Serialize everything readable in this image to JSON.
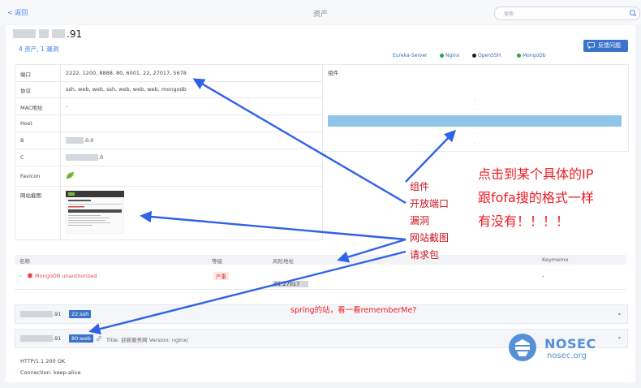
{
  "header": {
    "back": "< 返回",
    "title": "资产",
    "search_placeholder": "搜索"
  },
  "asset": {
    "ip_suffix": ".91",
    "counts": "4 资产, 1 漏洞",
    "feedback": "反馈问题"
  },
  "info_rows": [
    {
      "label": "端口",
      "value": "2222, 1200, 8888, 80, 6001, 22, 27017, 5678"
    },
    {
      "label": "协议",
      "value": "ssh, web, web, ssh, web, web, web, mongodb"
    },
    {
      "label": "MAC地址",
      "value": "-"
    },
    {
      "label": "Host",
      "value": "-"
    },
    {
      "label": "B",
      "value": ".0.0"
    },
    {
      "label": "C",
      "value": ".0"
    },
    {
      "label": "Favicon",
      "value": ""
    },
    {
      "label": "网站截图",
      "value": ""
    }
  ],
  "components": {
    "header": "组件",
    "dashes": [
      "-",
      "-",
      "-",
      "-",
      "-"
    ],
    "tags": [
      "Eureka-Server",
      "Nginx",
      "OpenSSH",
      "MongoDb"
    ]
  },
  "vuln_table": {
    "headers": [
      "名称",
      "等级",
      "风险地址",
      "Keymemo"
    ],
    "row": {
      "name": "MongoDB unauthorized",
      "level": "严重",
      "address": ".91:27017",
      "keymemo": "-"
    }
  },
  "ports": [
    {
      "ip": ".91",
      "badge": "22:ssh"
    },
    {
      "ip": ".91",
      "badge": "80:web",
      "detail": "Title: 迎新服务网   Version: nginx/"
    }
  ],
  "http": [
    "HTTP/1.1 200 OK",
    "Connection: keep-alive"
  ],
  "annotations": {
    "list": [
      "组件",
      "开放端口",
      "漏洞",
      "网站截图",
      "请求包"
    ],
    "big": [
      "点击到某个具体的IP",
      "跟fofa搜的格式一样",
      "有没有！！！！"
    ],
    "spring": "spring的站，看一看rememberMe?"
  },
  "logo": {
    "name": "NOSEC",
    "site": "nosec.org"
  },
  "colors": {
    "accent": "#3a73c9",
    "highlight": "#8ec5e8",
    "annotation": "#ee1c24",
    "arrow": "#2f62e8"
  }
}
